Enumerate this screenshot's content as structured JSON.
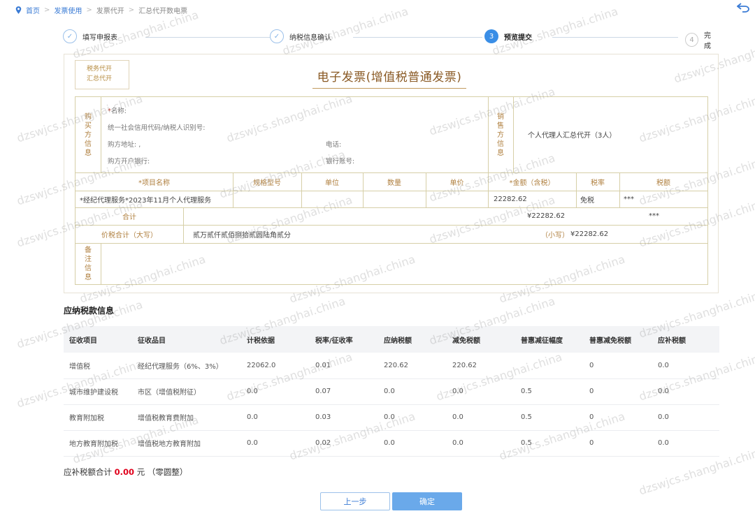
{
  "breadcrumb": {
    "home": "首页",
    "items": [
      "发票使用",
      "发票代开",
      "汇总代开数电票"
    ]
  },
  "steps": [
    {
      "num": "✓",
      "label": "填写申报表",
      "state": "done"
    },
    {
      "num": "✓",
      "label": "纳税信息确认",
      "state": "done"
    },
    {
      "num": "3",
      "label": "预览提交",
      "state": "active"
    },
    {
      "num": "4",
      "label": "完成",
      "state": "todo"
    }
  ],
  "invoice": {
    "stamp_line1": "税务代开",
    "stamp_line2": "汇总代开",
    "title": "电子发票(增值税普通发票)",
    "buyer_label": [
      "购",
      "买",
      "方",
      "信",
      "息"
    ],
    "seller_label": [
      "销",
      "售",
      "方",
      "信",
      "息"
    ],
    "remark_label": [
      "备",
      "注",
      "信",
      "息"
    ],
    "buyer_fields": {
      "name": "名称:",
      "tax_id": "统一社会信用代码/纳税人识别号:",
      "address": "购方地址: ,",
      "phone": "电话:",
      "bank": "购方开户银行:",
      "account": "银行账号:"
    },
    "seller_name": "个人代理人汇总代开（3人）",
    "headers": [
      "*项目名称",
      "规格型号",
      "单位",
      "数量",
      "单价",
      "*金额（含税）",
      "税率",
      "税额"
    ],
    "item": {
      "name": "*经纪代理服务*2023年11月个人代理服务",
      "amount": "22282.62",
      "rate": "免税",
      "tax": "***"
    },
    "total_label": "合计",
    "total_amount": "¥22282.62",
    "total_tax": "***",
    "price_tax_label": "价税合计（大写）",
    "price_tax_upper": "贰万贰仟贰佰捌拾贰圆陆角贰分",
    "price_tax_small_label": "（小写）",
    "price_tax_small": "¥22282.62"
  },
  "tax_section": {
    "title": "应纳税款信息",
    "headers": [
      "征收项目",
      "征收品目",
      "计税依据",
      "税率/征收率",
      "应纳税额",
      "减免税额",
      "普惠减征幅度",
      "普惠减免税额",
      "应补税额"
    ],
    "rows": [
      [
        "增值税",
        "经纪代理服务（6%、3%）",
        "22062.0",
        "0.01",
        "220.62",
        "220.62",
        "",
        "0",
        "0.0"
      ],
      [
        "城市维护建设税",
        "市区（增值税附征）",
        "0.0",
        "0.07",
        "0.0",
        "0.0",
        "0.5",
        "0",
        "0.0"
      ],
      [
        "教育附加税",
        "增值税教育费附加",
        "0.0",
        "0.03",
        "0.0",
        "0.0",
        "0.5",
        "0",
        "0.0"
      ],
      [
        "地方教育附加税",
        "增值税地方教育附加",
        "0.0",
        "0.02",
        "0.0",
        "0.0",
        "0.5",
        "0",
        "0.0"
      ]
    ]
  },
  "summary": {
    "label": "应补税额合计",
    "amount": "0.00",
    "unit": "元",
    "note": "（零圆整）"
  },
  "buttons": {
    "prev": "上一步",
    "confirm": "确定"
  },
  "watermark": "dzswjcs.shanghai.china"
}
